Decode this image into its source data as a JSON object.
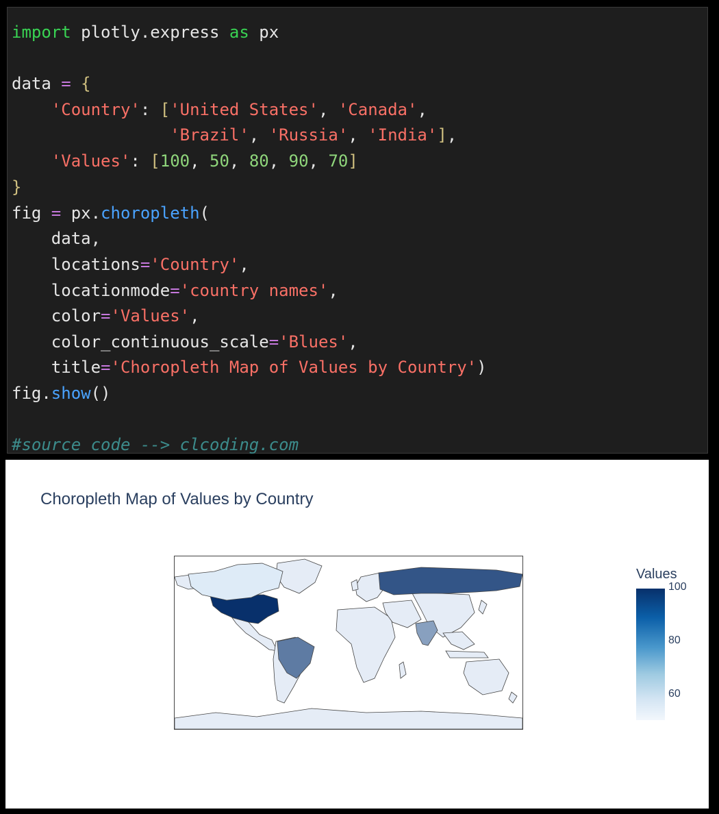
{
  "code": {
    "line1": {
      "kw1": "import",
      "mod": " plotly.express ",
      "kw2": "as",
      "alias": " px"
    },
    "line3": {
      "name": "data ",
      "op": "=",
      "brace": " {"
    },
    "line4": {
      "indent": "    ",
      "key": "'Country'",
      "sep": ": ",
      "br": "[",
      "s1": "'United States'",
      "c1": ", ",
      "s2": "'Canada'",
      "c2": ","
    },
    "line5": {
      "indent": "                ",
      "s3": "'Brazil'",
      "c3": ", ",
      "s4": "'Russia'",
      "c4": ", ",
      "s5": "'India'",
      "br": "]",
      "c5": ","
    },
    "line6": {
      "indent": "    ",
      "key": "'Values'",
      "sep": ": ",
      "br1": "[",
      "n1": "100",
      "c1": ", ",
      "n2": "50",
      "c2": ", ",
      "n3": "80",
      "c3": ", ",
      "n4": "90",
      "c4": ", ",
      "n5": "70",
      "br2": "]"
    },
    "line7": {
      "brace": "}"
    },
    "line8": {
      "name": "fig ",
      "op": "=",
      "obj": " px.",
      "fn": "choropleth",
      "paren": "("
    },
    "line9": {
      "text": "    data,"
    },
    "line10": {
      "arg": "    locations",
      "op": "=",
      "val": "'Country'",
      "tail": ","
    },
    "line11": {
      "arg": "    locationmode",
      "op": "=",
      "val": "'country names'",
      "tail": ","
    },
    "line12": {
      "arg": "    color",
      "op": "=",
      "val": "'Values'",
      "tail": ","
    },
    "line13": {
      "arg": "    color_continuous_scale",
      "op": "=",
      "val": "'Blues'",
      "tail": ","
    },
    "line14": {
      "arg": "    title",
      "op": "=",
      "val": "'Choropleth Map of Values by Country'",
      "tail": ")"
    },
    "line15": {
      "obj": "fig.",
      "fn": "show",
      "paren": "()"
    },
    "line17": {
      "comment": "#source code --> clcoding.com"
    }
  },
  "colors": {
    "code_bg": "#1e1e1e",
    "keyword": "#39d353",
    "string": "#f97066",
    "number": "#8fd57b",
    "operator": "#c678dd",
    "function": "#4aa3ff",
    "comment": "#3c8c8c",
    "title": "#2a3f5f"
  },
  "chart_data": {
    "type": "choropleth",
    "title": "Choropleth Map of Values by Country",
    "locations": [
      "United States",
      "Canada",
      "Brazil",
      "Russia",
      "India"
    ],
    "values": [
      100,
      50,
      80,
      90,
      70
    ],
    "color_scale": "Blues",
    "colorbar": {
      "title": "Values",
      "ticks": [
        "100",
        "80",
        "60"
      ]
    },
    "projection": "equirectangular",
    "missing_fill": "#e5ecf6"
  }
}
